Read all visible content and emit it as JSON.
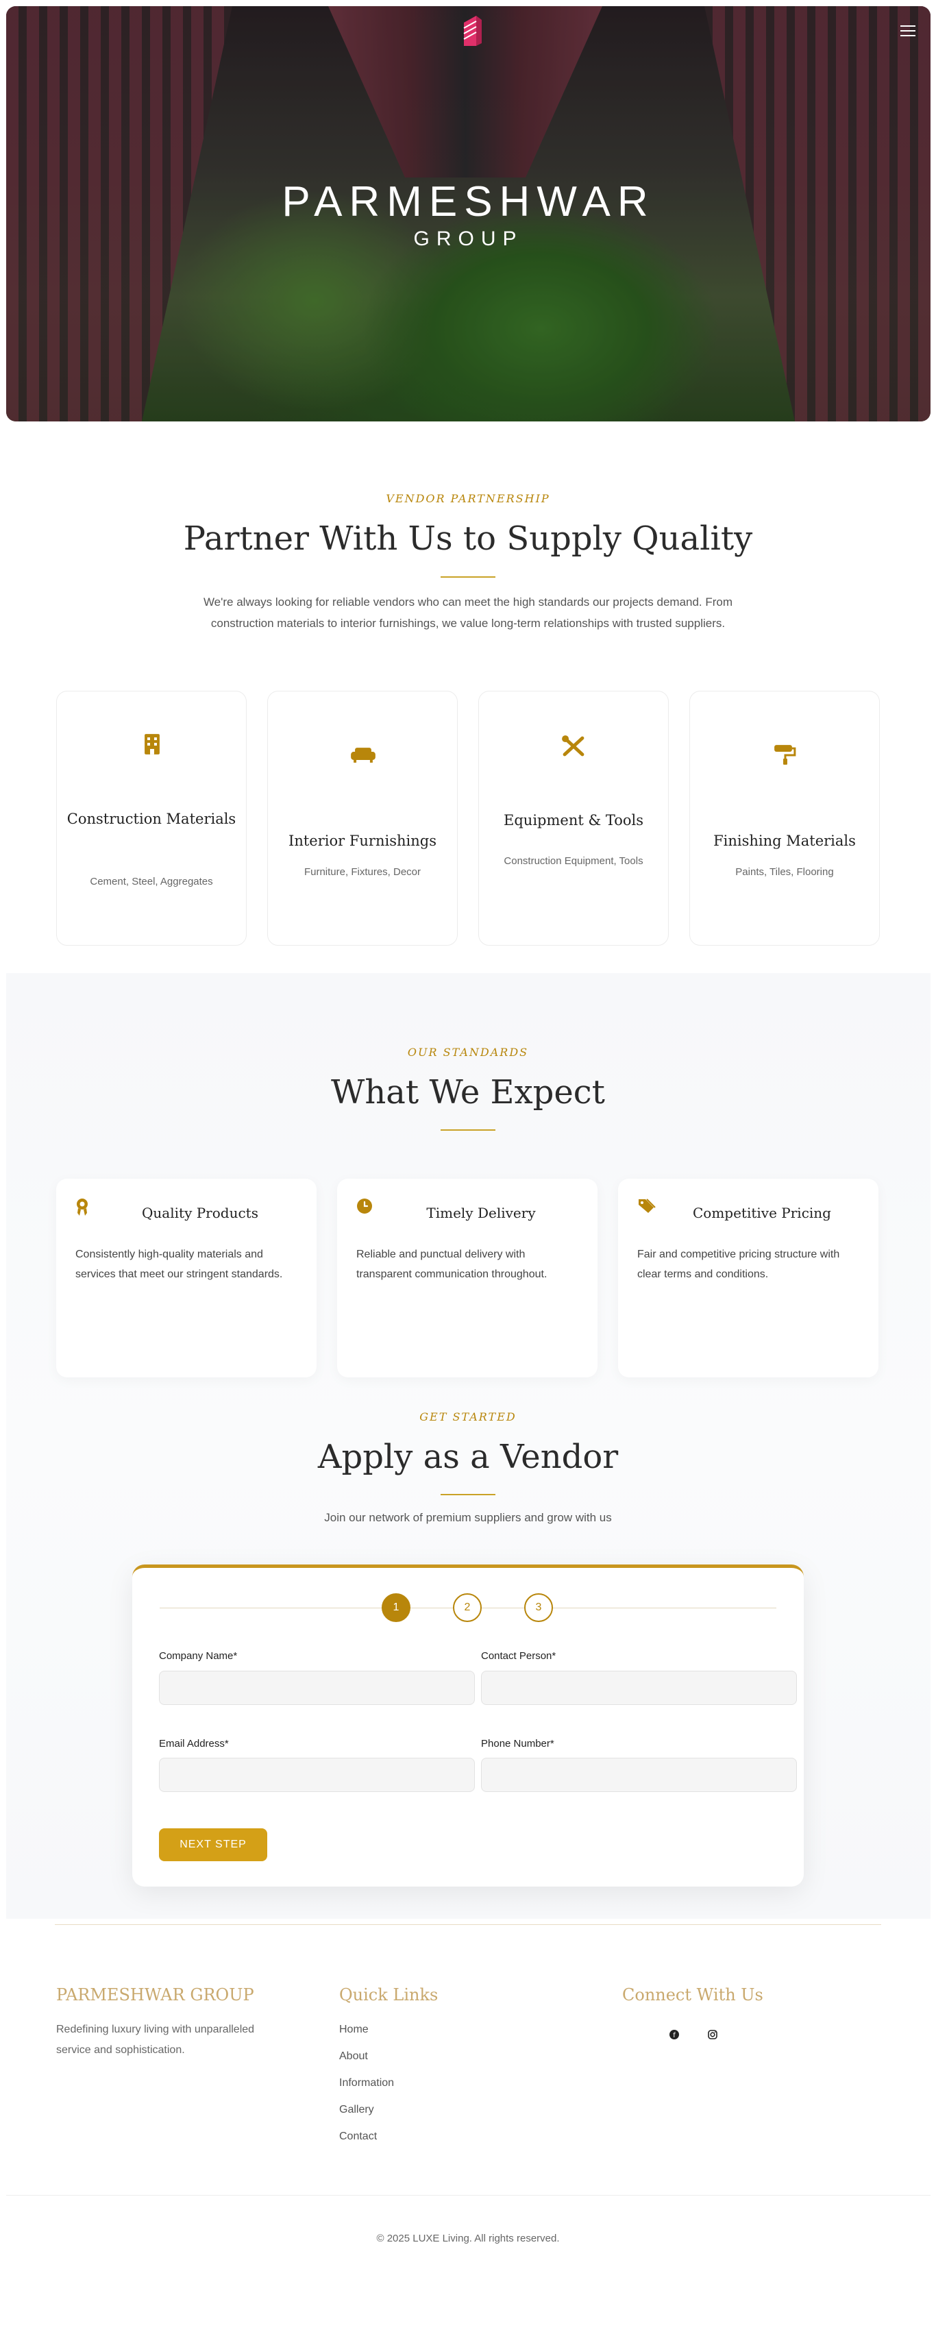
{
  "colors": {
    "accent": "#b8860b",
    "button": "#d4a017",
    "footer_heading": "#c9a96e"
  },
  "hero": {
    "brand_line1": "PARMESHWAR",
    "brand_line2": "GROUP",
    "menu_icon": "hamburger-icon",
    "logo_icon": "building-mark-icon"
  },
  "vendor": {
    "eyebrow": "VENDOR PARTNERSHIP",
    "title": "Partner With Us to Supply Quality",
    "lead": "We're always looking for reliable vendors who can meet the high standards our projects demand. From construction materials to interior furnishings, we value long-term relationships with trusted suppliers.",
    "cards": [
      {
        "icon": "building-icon",
        "title": "Construction Materials",
        "sub": "Cement, Steel, Aggregates"
      },
      {
        "icon": "couch-icon",
        "title": "Interior Furnishings",
        "sub": "Furniture, Fixtures, Decor"
      },
      {
        "icon": "tools-icon",
        "title": "Equipment & Tools",
        "sub": "Construction Equipment, Tools"
      },
      {
        "icon": "paint-roller-icon",
        "title": "Finishing Materials",
        "sub": "Paints, Tiles, Flooring"
      }
    ]
  },
  "standards": {
    "eyebrow": "OUR STANDARDS",
    "title": "What We Expect",
    "cards": [
      {
        "icon": "award-icon",
        "title": "Quality Products",
        "desc": "Consistently high-quality materials and services that meet our stringent standards."
      },
      {
        "icon": "clock-icon",
        "title": "Timely Delivery",
        "desc": "Reliable and punctual delivery with transparent communication throughout."
      },
      {
        "icon": "tags-icon",
        "title": "Competitive Pricing",
        "desc": "Fair and competitive pricing structure with clear terms and conditions."
      }
    ]
  },
  "apply": {
    "eyebrow": "GET STARTED",
    "title": "Apply as a Vendor",
    "lead": "Join our network of premium suppliers and grow with us",
    "steps": [
      "1",
      "2",
      "3"
    ],
    "fields": {
      "company_label": "Company Name*",
      "contact_label": "Contact Person*",
      "email_label": "Email Address*",
      "phone_label": "Phone Number*"
    },
    "next_label": "NEXT STEP"
  },
  "footer": {
    "brand_title": "PARMESHWAR GROUP",
    "brand_text": "Redefining luxury living with unparalleled service and sophistication.",
    "links_title": "Quick Links",
    "links": [
      "Home",
      "About",
      "Information",
      "Gallery",
      "Contact"
    ],
    "connect_title": "Connect With Us",
    "social": [
      {
        "icon": "facebook-icon",
        "glyph": "f"
      },
      {
        "icon": "instagram-icon",
        "glyph": "◎"
      }
    ],
    "copyright": "© 2025 LUXE Living. All rights reserved."
  }
}
